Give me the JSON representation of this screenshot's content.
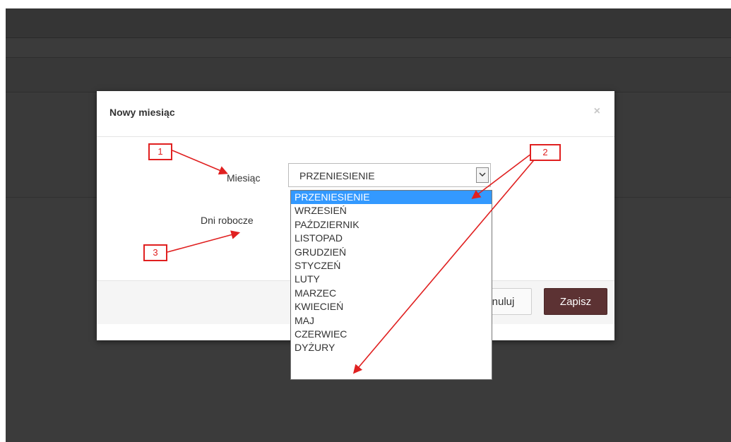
{
  "modal": {
    "title": "Nowy miesiąc",
    "close_glyph": "×",
    "month_label": "Miesiąc",
    "work_days_label": "Dni robocze",
    "cancel_label": "Anuluj",
    "save_label": "Zapisz"
  },
  "month_select": {
    "value": "PRZENIESIENIE",
    "options": [
      "PRZENIESIENIE",
      "WRZESIEŃ",
      "PAŹDZIERNIK",
      "LISTOPAD",
      "GRUDZIEŃ",
      "STYCZEŃ",
      "LUTY",
      "MARZEC",
      "KWIECIEŃ",
      "MAJ",
      "CZERWIEC",
      "DYŻURY"
    ],
    "selected_index": 0
  },
  "annotations": {
    "callout1": "1",
    "callout2": "2",
    "callout3": "3"
  },
  "colors": {
    "save_button": "#5c3233",
    "selected_option": "#3399ff",
    "annotation": "#e02020"
  }
}
